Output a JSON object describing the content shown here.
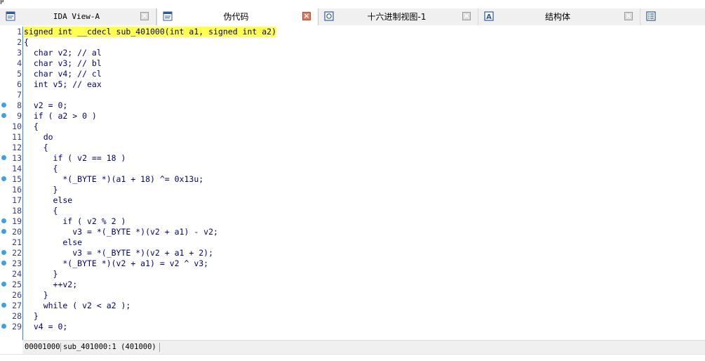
{
  "top_mark": "P",
  "tabs": [
    {
      "label": "IDA View-A",
      "icon": "ida-view-icon",
      "close": "×"
    },
    {
      "label": "伪代码",
      "icon": "pseudocode-icon",
      "close": "×"
    },
    {
      "label": "十六进制视图-1",
      "icon": "hex-view-icon",
      "close": "×"
    },
    {
      "label": "结构体",
      "icon": "structures-icon",
      "close": "×"
    },
    {
      "label": "",
      "icon": "enums-icon"
    }
  ],
  "code": {
    "lines": [
      {
        "n": "1",
        "text": "signed int __cdecl sub_401000(int a1, signed int a2)",
        "bp": false
      },
      {
        "n": "2",
        "text": "{",
        "bp": false
      },
      {
        "n": "3",
        "text": "  char v2; // al",
        "bp": false
      },
      {
        "n": "4",
        "text": "  char v3; // bl",
        "bp": false
      },
      {
        "n": "5",
        "text": "  char v4; // cl",
        "bp": false
      },
      {
        "n": "6",
        "text": "  int v5; // eax",
        "bp": false
      },
      {
        "n": "7",
        "text": "",
        "bp": false
      },
      {
        "n": "8",
        "text": "  v2 = 0;",
        "bp": true
      },
      {
        "n": "9",
        "text": "  if ( a2 > 0 )",
        "bp": true
      },
      {
        "n": "10",
        "text": "  {",
        "bp": false
      },
      {
        "n": "11",
        "text": "    do",
        "bp": false
      },
      {
        "n": "12",
        "text": "    {",
        "bp": false
      },
      {
        "n": "13",
        "text": "      if ( v2 == 18 )",
        "bp": true
      },
      {
        "n": "14",
        "text": "      {",
        "bp": false
      },
      {
        "n": "15",
        "text": "        *(_BYTE *)(a1 + 18) ^= 0x13u;",
        "bp": true
      },
      {
        "n": "16",
        "text": "      }",
        "bp": false
      },
      {
        "n": "17",
        "text": "      else",
        "bp": false
      },
      {
        "n": "18",
        "text": "      {",
        "bp": false
      },
      {
        "n": "19",
        "text": "        if ( v2 % 2 )",
        "bp": true
      },
      {
        "n": "20",
        "text": "          v3 = *(_BYTE *)(v2 + a1) - v2;",
        "bp": true
      },
      {
        "n": "21",
        "text": "        else",
        "bp": false
      },
      {
        "n": "22",
        "text": "          v3 = *(_BYTE *)(v2 + a1 + 2);",
        "bp": true
      },
      {
        "n": "23",
        "text": "        *(_BYTE *)(v2 + a1) = v2 ^ v3;",
        "bp": true
      },
      {
        "n": "24",
        "text": "      }",
        "bp": false
      },
      {
        "n": "25",
        "text": "      ++v2;",
        "bp": true
      },
      {
        "n": "26",
        "text": "    }",
        "bp": false
      },
      {
        "n": "27",
        "text": "    while ( v2 < a2 );",
        "bp": true
      },
      {
        "n": "28",
        "text": "  }",
        "bp": false
      },
      {
        "n": "29",
        "text": "  v4 = 0;",
        "bp": true
      }
    ]
  },
  "status": {
    "offset": "00001000",
    "location": "sub_401000:1 (401000)"
  },
  "colors": {
    "highlight": "#ffff4d",
    "breakpoint_dot": "#3aa0e8",
    "close_active": "#e07a5f"
  }
}
